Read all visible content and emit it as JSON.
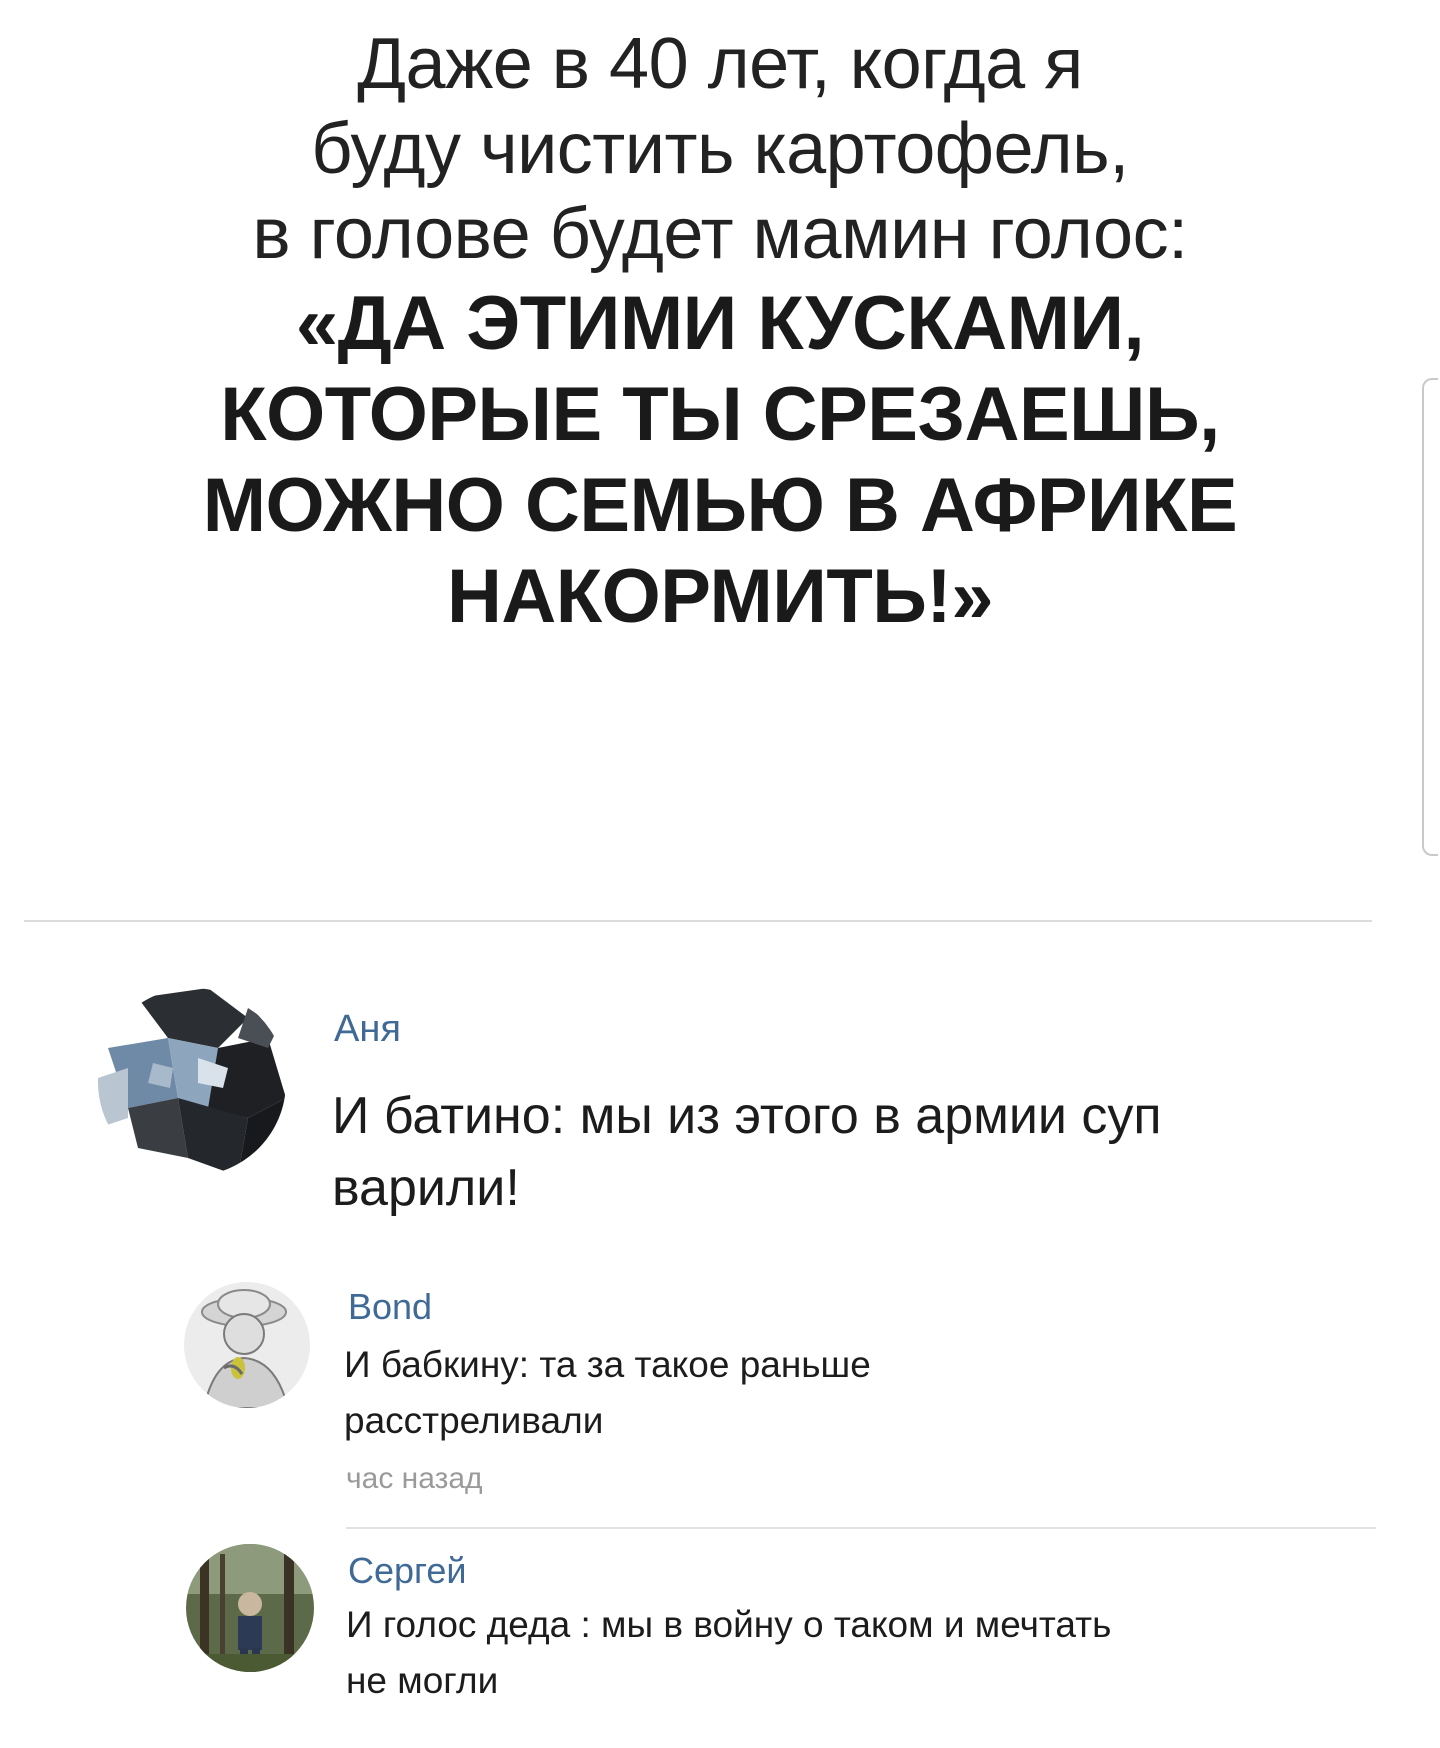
{
  "post": {
    "lines": [
      "Даже в 40 лет, когда я",
      "буду чистить картофель,",
      "в голове будет мамин голос:"
    ],
    "quote_lines": [
      "«ДА ЭТИМИ КУСКАМИ,",
      "КОТОРЫЕ ТЫ СРЕЗАЕШЬ,",
      "МОЖНО СЕМЬЮ В АФРИКЕ",
      "НАКОРМИТЬ!»"
    ]
  },
  "comments": [
    {
      "author": "Аня",
      "text_lines": [
        "И батино: мы из этого в армии суп",
        "варили!"
      ],
      "time": ""
    },
    {
      "author": "Bond",
      "text_lines": [
        "И бабкину: та за такое раньше",
        "расстреливали"
      ],
      "time": "час назад"
    },
    {
      "author": "Сергей",
      "text_lines": [
        "И голос деда : мы в войну о таком и мечтать",
        "не могли"
      ],
      "time": ""
    }
  ],
  "colors": {
    "author": "#3f6a96",
    "text": "#1c1c1c",
    "time": "#9a9a9a",
    "divider": "#dcdcdc"
  },
  "icons": {
    "avatar_1": "mosaic-photo-avatar",
    "avatar_2": "sketch-portrait-avatar",
    "avatar_3": "forest-photo-avatar"
  }
}
